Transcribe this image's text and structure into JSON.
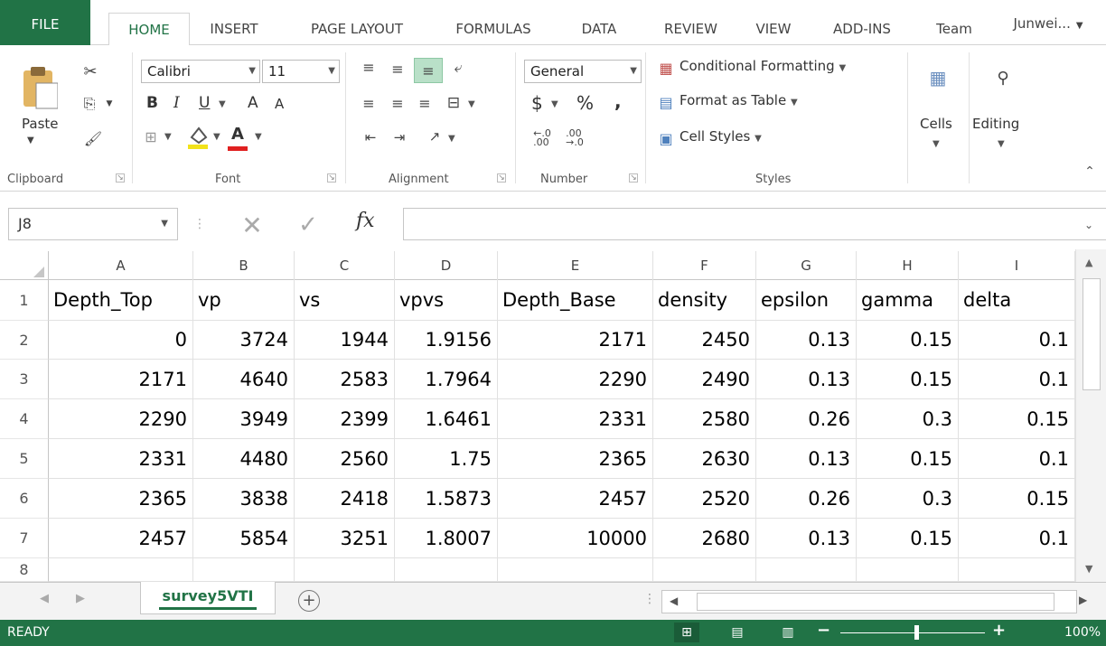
{
  "ribbon_tabs": [
    "FILE",
    "HOME",
    "INSERT",
    "PAGE LAYOUT",
    "FORMULAS",
    "DATA",
    "REVIEW",
    "VIEW",
    "ADD-INS",
    "Team"
  ],
  "user_name": "Junwei...",
  "clipboard": {
    "paste_label": "Paste",
    "group_label": "Clipboard"
  },
  "font": {
    "name": "Calibri",
    "size": "11",
    "bold": "B",
    "italic": "I",
    "underline": "U",
    "grow": "A",
    "shrink": "A",
    "font_color": "A",
    "group_label": "Font"
  },
  "alignment": {
    "group_label": "Alignment"
  },
  "number": {
    "format": "General",
    "currency": "$",
    "percent": "%",
    "comma": ",",
    "group_label": "Number"
  },
  "styles": {
    "conditional": "Conditional Formatting",
    "format_table": "Format as Table",
    "cell_styles": "Cell Styles",
    "group_label": "Styles"
  },
  "cells": {
    "label": "Cells"
  },
  "editing": {
    "label": "Editing"
  },
  "formula_bar": {
    "name_box": "J8",
    "fx": "fx",
    "formula": ""
  },
  "columns": [
    "A",
    "B",
    "C",
    "D",
    "E",
    "F",
    "G",
    "H",
    "I"
  ],
  "rows": [
    "1",
    "2",
    "3",
    "4",
    "5",
    "6",
    "7",
    "8"
  ],
  "table": {
    "headers": [
      "Depth_Top",
      "vp",
      "vs",
      "vpvs",
      "Depth_Base",
      "density",
      "epsilon",
      "gamma",
      "delta"
    ],
    "data": [
      [
        "0",
        "3724",
        "1944",
        "1.9156",
        "2171",
        "2450",
        "0.13",
        "0.15",
        "0.1"
      ],
      [
        "2171",
        "4640",
        "2583",
        "1.7964",
        "2290",
        "2490",
        "0.13",
        "0.15",
        "0.1"
      ],
      [
        "2290",
        "3949",
        "2399",
        "1.6461",
        "2331",
        "2580",
        "0.26",
        "0.3",
        "0.15"
      ],
      [
        "2331",
        "4480",
        "2560",
        "1.75",
        "2365",
        "2630",
        "0.13",
        "0.15",
        "0.1"
      ],
      [
        "2365",
        "3838",
        "2418",
        "1.5873",
        "2457",
        "2520",
        "0.26",
        "0.3",
        "0.15"
      ],
      [
        "2457",
        "5854",
        "3251",
        "1.8007",
        "10000",
        "2680",
        "0.13",
        "0.15",
        "0.1"
      ]
    ]
  },
  "sheet_tab": "survey5VTI",
  "status": {
    "ready": "READY",
    "zoom": "100%"
  },
  "colors": {
    "excel_green": "#217346",
    "underline_red": "#e02020",
    "highlight_yellow": "#f2e21a"
  }
}
